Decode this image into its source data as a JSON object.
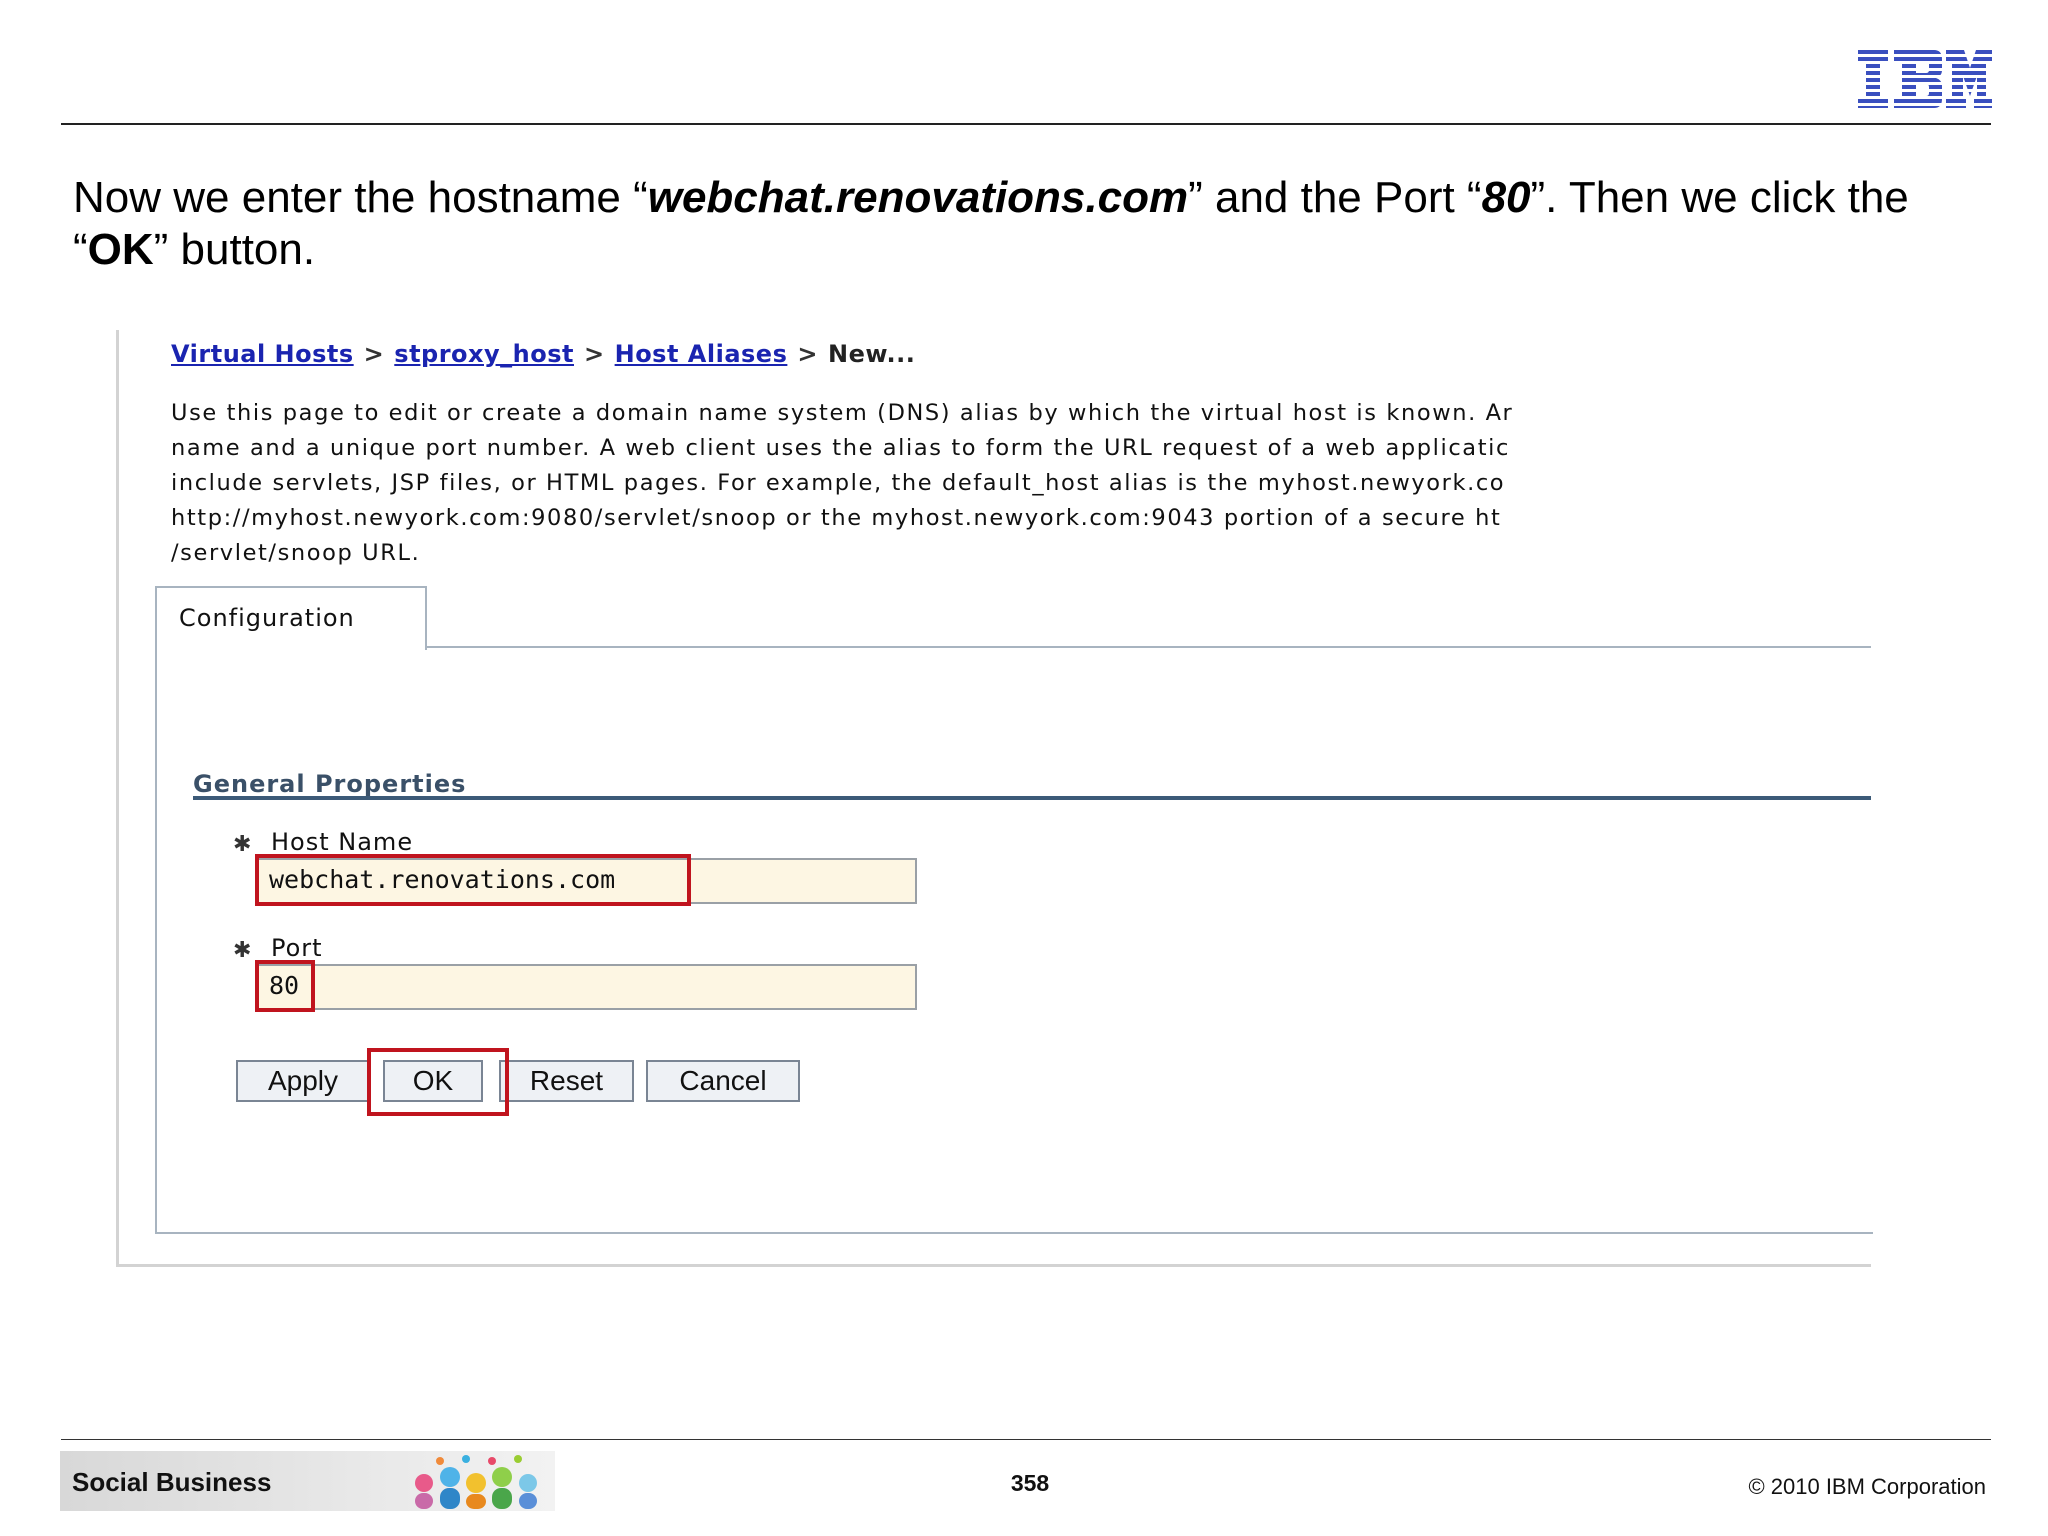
{
  "header": {
    "logo": "IBM"
  },
  "intro": {
    "p1": "Now we enter the hostname “",
    "hostname": "webchat.renovations.com",
    "p2": "” and the Port “",
    "port": "80",
    "p3": "”. Then we click the “",
    "ok": "OK",
    "p4": "” button."
  },
  "breadcrumb": {
    "item1": "Virtual Hosts",
    "item2": "stproxy_host",
    "item3": "Host Aliases",
    "current": "New...",
    "separator": ">"
  },
  "description": {
    "line1": "Use this page to edit or create a domain name system (DNS) alias by which the virtual host is known. Ar",
    "line2": "name and a unique port number. A web client uses the alias to form the URL request of a web applicatic",
    "line3": "include servlets, JSP files, or HTML pages. For example, the default_host alias is the myhost.newyork.co",
    "line4": "http://myhost.newyork.com:9080/servlet/snoop or the myhost.newyork.com:9043 portion of a secure ht",
    "line5": "/servlet/snoop URL."
  },
  "tabs": {
    "configuration": "Configuration"
  },
  "general_properties": {
    "title": "General Properties",
    "required_marker": "✱",
    "host_name_label": "Host Name",
    "host_name_value": "webchat.renovations.com",
    "port_label": "Port",
    "port_value": "80"
  },
  "buttons": {
    "apply": "Apply",
    "ok": "OK",
    "reset": "Reset",
    "cancel": "Cancel"
  },
  "footer": {
    "brand": "Social Business",
    "page_number": "358",
    "copyright": "© 2010 IBM Corporation"
  },
  "colors": {
    "highlight": "#c0141e",
    "link": "#1a24b0",
    "ibm_blue": "#3a4fbf"
  }
}
